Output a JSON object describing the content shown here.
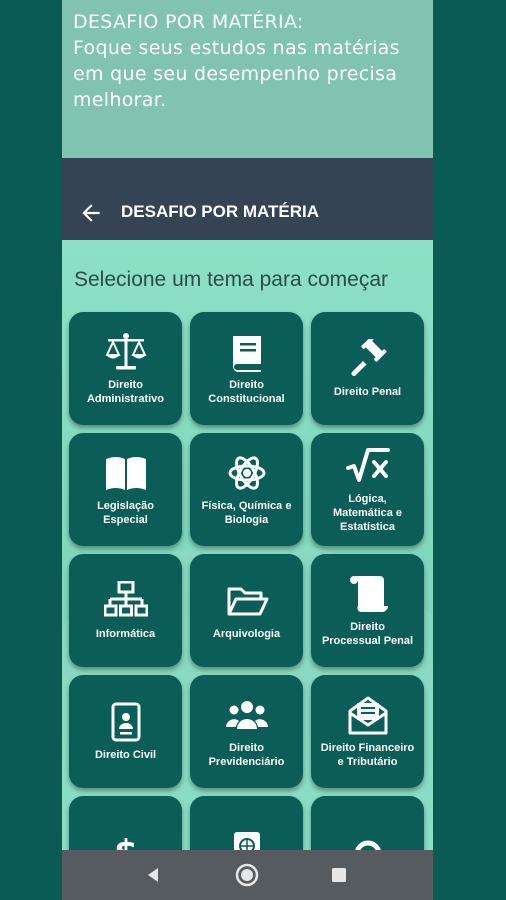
{
  "banner": {
    "lines": [
      "DESAFIO POR MATÉRIA:",
      "Foque seus estudos nas matérias",
      "em que seu desempenho precisa",
      "melhorar."
    ]
  },
  "appbar": {
    "title": "DESAFIO POR MATÉRIA",
    "back_icon": "arrow-left-icon"
  },
  "heading": "Selecione um tema para começar",
  "subjects": [
    {
      "label": "Direito Administrativo",
      "icon": "scale-icon"
    },
    {
      "label": "Direito Constitucional",
      "icon": "book-icon"
    },
    {
      "label": "Direito Penal",
      "icon": "gavel-icon"
    },
    {
      "label": "Legislação Especial",
      "icon": "open-book-icon"
    },
    {
      "label": "Física, Química e Biologia",
      "icon": "atom-icon"
    },
    {
      "label": "Lógica, Matemática e Estatística",
      "icon": "square-root-icon"
    },
    {
      "label": "Informática",
      "icon": "network-icon"
    },
    {
      "label": "Arquivologia",
      "icon": "folder-open-icon"
    },
    {
      "label": "Direito Processual Penal",
      "icon": "scroll-icon"
    },
    {
      "label": "Direito Civil",
      "icon": "id-card-icon"
    },
    {
      "label": "Direito Previdenciário",
      "icon": "users-icon"
    },
    {
      "label": "Direito Financeiro e Tributário",
      "icon": "envelope-open-icon"
    },
    {
      "label": "",
      "icon": "dollar-icon"
    },
    {
      "label": "",
      "icon": "passport-icon"
    },
    {
      "label": "",
      "icon": "circle-icon"
    }
  ],
  "navigation_bar": [
    "back-triangle-icon",
    "home-circle-icon",
    "recents-square-icon"
  ],
  "colors": {
    "tile": "#0b5d57",
    "appbar": "#344454",
    "background": "#8ad9c0",
    "banner": "#80c4b0"
  }
}
